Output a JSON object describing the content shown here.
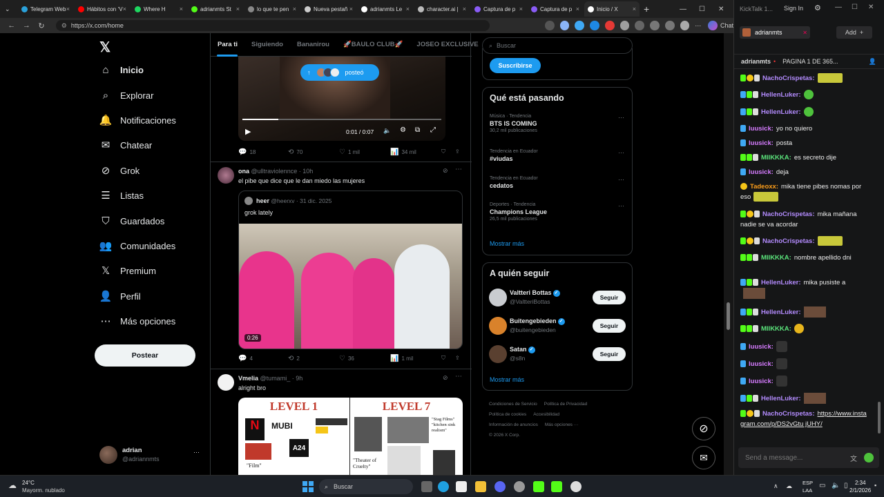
{
  "browser": {
    "tabs": [
      {
        "label": "Telegram Web",
        "color": "#2aa1da"
      },
      {
        "label": "Hábitos con ‘V",
        "color": "#ff0000"
      },
      {
        "label": "Where H",
        "color": "#1ed760"
      },
      {
        "label": "adrianmts St",
        "color": "#53fc18"
      },
      {
        "label": "lo que te pen",
        "color": "#888888"
      },
      {
        "label": "Nueva pestañ",
        "color": "#cccccc"
      },
      {
        "label": "adrianmts Le",
        "color": "#ffffff"
      },
      {
        "label": "character.ai |",
        "color": "#bbbbbb"
      },
      {
        "label": "Captura de p",
        "color": "#8a5cf6"
      },
      {
        "label": "Captura de p",
        "color": "#8a5cf6"
      },
      {
        "label": "Inicio / X",
        "color": "#ffffff"
      }
    ],
    "url": "https://x.com/home",
    "chat_button": "Chat"
  },
  "sidebar": {
    "logo": "𝕏",
    "items": [
      {
        "label": "Inicio",
        "icon": "⌂"
      },
      {
        "label": "Explorar",
        "icon": "⌕"
      },
      {
        "label": "Notificaciones",
        "icon": "🔔"
      },
      {
        "label": "Chatear",
        "icon": "✉"
      },
      {
        "label": "Grok",
        "icon": "⊘"
      },
      {
        "label": "Listas",
        "icon": "☰"
      },
      {
        "label": "Guardados",
        "icon": "⛉"
      },
      {
        "label": "Comunidades",
        "icon": "👥"
      },
      {
        "label": "Premium",
        "icon": "𝕏"
      },
      {
        "label": "Perfil",
        "icon": "👤"
      },
      {
        "label": "Más opciones",
        "icon": "⋯"
      }
    ],
    "post_button": "Postear",
    "account": {
      "name": "adrian",
      "handle": "@adriannmts",
      "more": "···"
    }
  },
  "feed": {
    "tabs": [
      "Para ti",
      "Siguiendo",
      "Bananirou",
      "🚀BAULO CLUB🚀",
      "JOSEO EXCLUSIVE"
    ],
    "posted_pill": "posteó",
    "video1": {
      "time": "0:01 / 0:07"
    },
    "post1_actions": {
      "replies": "18",
      "reposts": "70",
      "likes": "1 mil",
      "views": "34 mil"
    },
    "post2": {
      "name": "ona",
      "handle": "@ulltraviolennce · 10h",
      "text": "el pibe que dice que le dan miedo las mujeres",
      "quote": {
        "name": "heer",
        "handle": "@heerxv · 31 dic. 2025",
        "text": "grok lately",
        "duration": "0:26"
      },
      "actions": {
        "replies": "4",
        "reposts": "2",
        "likes": "36",
        "views": "1 mil"
      }
    },
    "post3": {
      "name": "Vmelia",
      "handle": "@tumami_ · 9h",
      "text": "alright bro",
      "image_left_title": "LEVEL 1",
      "image_right_title": "LEVEL 7",
      "image_left_labels": [
        "MUBI",
        "A24",
        "\"Film\""
      ],
      "image_right_labels": [
        "\"Theater of Cruelty\"",
        "\"Stag Films\" \"kitchen sink realism\""
      ]
    }
  },
  "right": {
    "search_placeholder": "Buscar",
    "subscribe": "Suscribirse",
    "trends_title": "Qué está pasando",
    "trends": [
      {
        "category": "Música · Tendencia",
        "name": "BTS IS COMING",
        "count": "30,2 mil publicaciones"
      },
      {
        "category": "Tendencia en Ecuador",
        "name": "#viudas",
        "count": ""
      },
      {
        "category": "Tendencia en Ecuador",
        "name": "cedatos",
        "count": ""
      },
      {
        "category": "Deportes · Tendencia",
        "name": "Champions League",
        "count": "26,5 mil publicaciones"
      }
    ],
    "trends_more": "Mostrar más",
    "follow_title": "A quién seguir",
    "follow": [
      {
        "name": "Valtteri Bottas",
        "handle": "@ValtteriBottas",
        "button": "Seguir"
      },
      {
        "name": "Buitengebieden",
        "handle": "@buitengebieden",
        "button": "Seguir"
      },
      {
        "name": "Satan",
        "handle": "@s8n",
        "button": "Seguir"
      }
    ],
    "follow_more": "Mostrar más",
    "footer": [
      "Condiciones de Servicio",
      "Política de Privacidad",
      "Política de cookies",
      "Accesibilidad",
      "Información de anuncios",
      "Más opciones ···",
      "© 2026 X Corp."
    ]
  },
  "chat": {
    "app_title": "KickTalk 1...",
    "sign_in": "Sign In",
    "channel": "adrianmts",
    "add": "Add",
    "header_user": "adrianmts",
    "header_text": "PAGINA 1 DE 365...",
    "messages": [
      {
        "user": "NachoCrispetas:",
        "text": "",
        "color": "#b48cff"
      },
      {
        "user": "HellenLuker:",
        "text": "",
        "color": "#b48cff"
      },
      {
        "user": "HellenLuker:",
        "text": "",
        "color": "#b48cff"
      },
      {
        "user": "luusick:",
        "text": "yo no quiero",
        "color": "#d67cff"
      },
      {
        "user": "luusick:",
        "text": "posta",
        "color": "#d67cff"
      },
      {
        "user": "MIIKKKA:",
        "text": "es secreto dije",
        "color": "#5be57c"
      },
      {
        "user": "luusick:",
        "text": "deja",
        "color": "#d67cff"
      },
      {
        "user": "Tadeoxx:",
        "text": "mika tiene pibes nomas por eso",
        "color": "#ff9f1a"
      },
      {
        "user": "NachoCrispetas:",
        "text": "mika mañana nadie se va acordar",
        "color": "#b48cff"
      },
      {
        "user": "NachoCrispetas:",
        "text": "",
        "color": "#b48cff"
      },
      {
        "user": "MIIKKKA:",
        "text": "nombre apellido dni",
        "color": "#5be57c"
      },
      {
        "user": "HellenLuker:",
        "text": "mika pusiste a",
        "color": "#b48cff"
      },
      {
        "user": "HellenLuker:",
        "text": "",
        "color": "#b48cff"
      },
      {
        "user": "MIIKKKA:",
        "text": "",
        "color": "#5be57c"
      },
      {
        "user": "luusick:",
        "text": "",
        "color": "#d67cff"
      },
      {
        "user": "luusick:",
        "text": "",
        "color": "#d67cff"
      },
      {
        "user": "luusick:",
        "text": "",
        "color": "#d67cff"
      },
      {
        "user": "HellenLuker:",
        "text": "",
        "color": "#b48cff"
      },
      {
        "user": "NachoCrispetas:",
        "text": "https://www.instagram.com/p/DS2vGtu jUHY/",
        "color": "#b48cff"
      }
    ],
    "input_placeholder": "Send a message..."
  },
  "taskbar": {
    "weather_temp": "24°C",
    "weather_desc": "Mayorm. nublado",
    "search": "Buscar",
    "lang1": "ESP",
    "lang2": "LAA",
    "time": "2:34",
    "date": "2/1/2026"
  }
}
